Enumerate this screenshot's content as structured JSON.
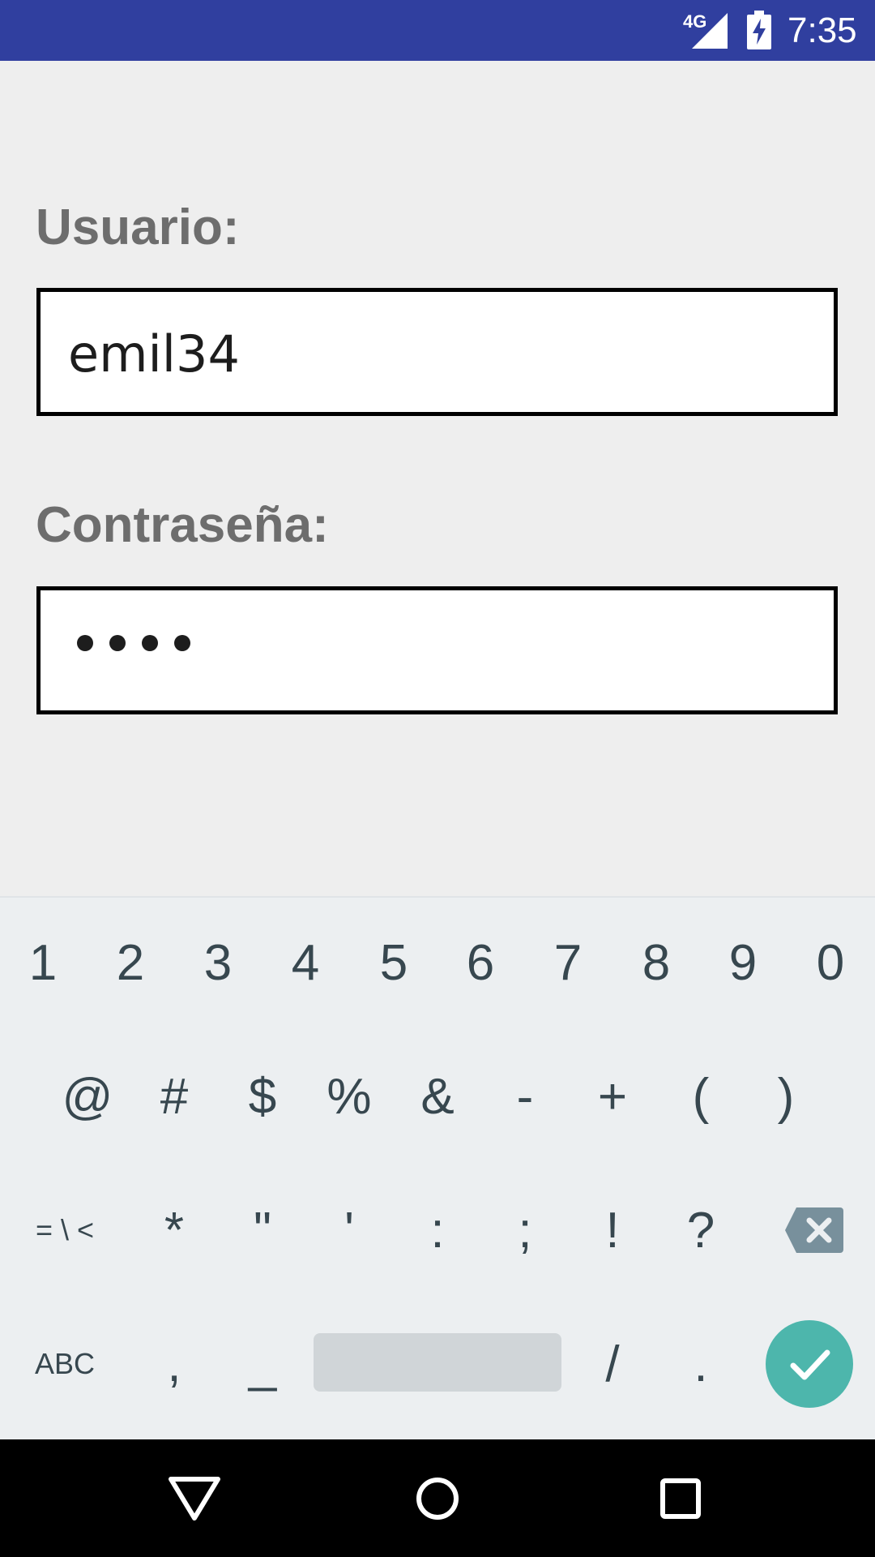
{
  "status_bar": {
    "network": "4G",
    "time": "7:35",
    "bar_color": "#303f9f"
  },
  "form": {
    "username_label": "Usuario:",
    "username_value": "emil34",
    "password_label": "Contraseña:",
    "password_masked": "••••"
  },
  "keyboard": {
    "row1": [
      "1",
      "2",
      "3",
      "4",
      "5",
      "6",
      "7",
      "8",
      "9",
      "0"
    ],
    "row2": [
      "@",
      "#",
      "$",
      "%",
      "&",
      "-",
      "+",
      "(",
      ")"
    ],
    "row3": [
      "= \\ <",
      "*",
      "\"",
      "'",
      ":",
      ";",
      "!",
      "?"
    ],
    "row4": [
      "ABC",
      ",",
      "_",
      "/",
      "."
    ],
    "enter_color": "#4db6ac"
  },
  "icons": {
    "signal": "cell-signal-icon",
    "battery": "battery-charging-icon",
    "delete": "backspace-icon",
    "enter": "check-icon",
    "back": "back-triangle-icon",
    "home": "home-circle-icon",
    "recents": "recents-square-icon"
  }
}
